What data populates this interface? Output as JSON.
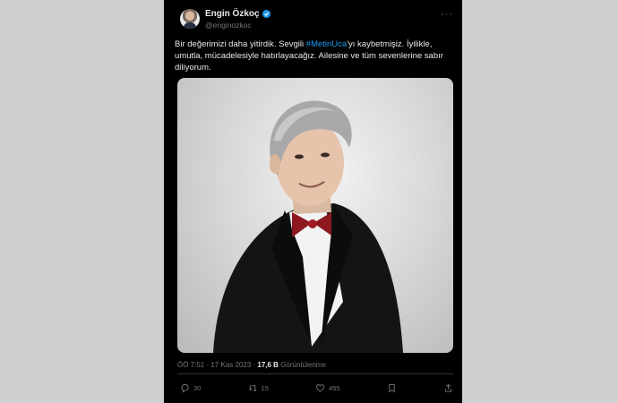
{
  "author": {
    "display_name": "Engin Özkoç",
    "handle": "@enginozkoc"
  },
  "tweet": {
    "text_before": "Bir değerimizi daha yitirdik. Sevgili ",
    "hashtag": "#MetinUca",
    "text_after": "'yı kaybetmişiz. İyilikle, umutla, mücadelesiyle hatırlayacağız. Ailesine ve tüm sevenlerine sabır diliyorum.",
    "timestamp": "ÖÖ 7:51 · 17 Kas 2023 · ",
    "views_count": "17,6 B",
    "views_label": " Görüntülenme"
  },
  "actions": {
    "reply_count": "30",
    "retweet_count": "15",
    "like_count": "455"
  },
  "colors": {
    "accent": "#1d9bf0",
    "background": "#000000",
    "muted": "#71767b"
  }
}
